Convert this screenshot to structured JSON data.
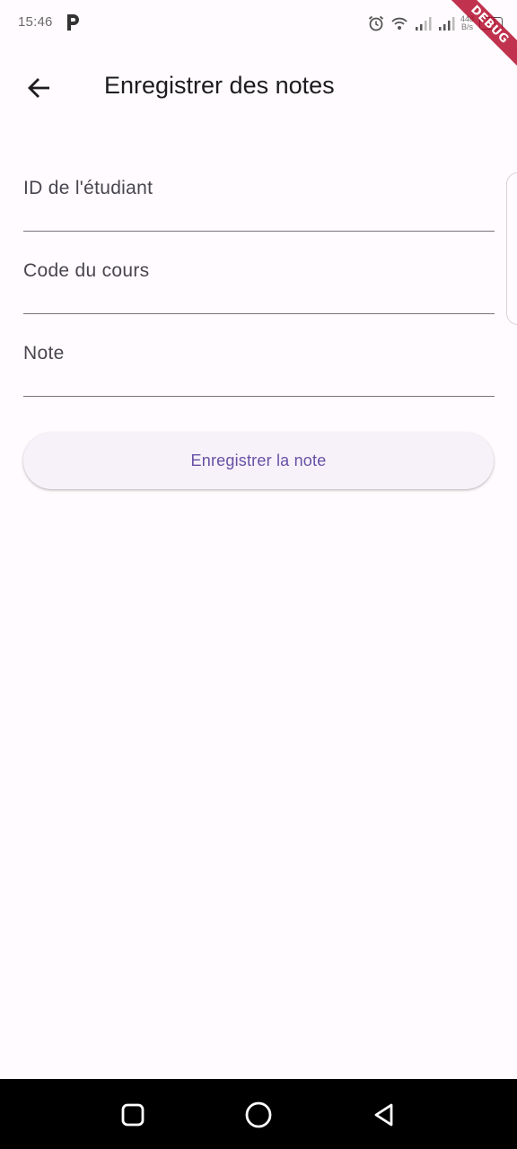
{
  "status_bar": {
    "time": "15:46",
    "net_speed_value": "448",
    "net_speed_unit": "B/s",
    "battery": "24",
    "icons": [
      "p-app-icon",
      "alarm-icon",
      "wifi-icon",
      "signal-icon",
      "signal-icon"
    ]
  },
  "debug_banner": "DEBUG",
  "app_bar": {
    "title": "Enregistrer des notes",
    "back_icon": "arrow-back-icon"
  },
  "form": {
    "fields": [
      {
        "label": "ID de l'étudiant",
        "value": ""
      },
      {
        "label": "Code du cours",
        "value": ""
      },
      {
        "label": "Note",
        "value": ""
      }
    ],
    "submit_label": "Enregistrer la note"
  },
  "nav_bar": {
    "buttons": [
      "recents-square-icon",
      "home-circle-icon",
      "back-triangle-icon"
    ]
  },
  "colors": {
    "background": "#fffbfe",
    "primary": "#6750a4",
    "button_bg": "#f7f2fa",
    "underline": "#79747e",
    "debug_banner": "#b00020"
  }
}
